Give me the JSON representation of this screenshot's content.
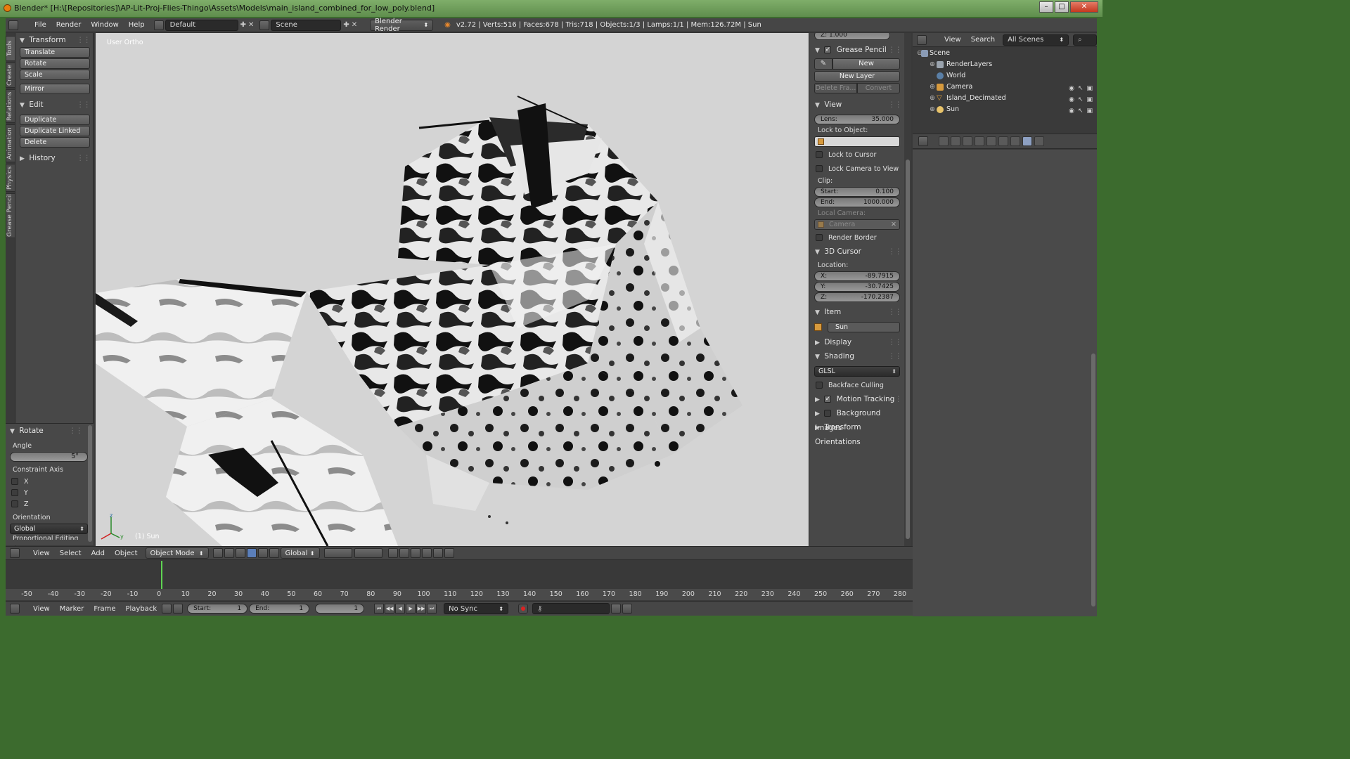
{
  "window": {
    "title": "Blender* [H:\\[Repositories]\\AP-Lit-Proj-Flies-Thingo\\Assets\\Models\\main_island_combined_for_low_poly.blend]",
    "controls": [
      "–",
      "□",
      "✕"
    ]
  },
  "topbar": {
    "menus": [
      "File",
      "Render",
      "Window",
      "Help"
    ],
    "layout": "Default",
    "scene": "Scene",
    "engine": "Blender Render",
    "stats": "v2.72 | Verts:516 | Faces:678 | Tris:718 | Objects:1/3 | Lamps:1/1 | Mem:126.72M | Sun"
  },
  "vertical_tabs": [
    "Tools",
    "Create",
    "Relations",
    "Animation",
    "Physics",
    "Grease Pencil"
  ],
  "toolshelf": {
    "transform": {
      "title": "Transform",
      "buttons": [
        "Translate",
        "Rotate",
        "Scale",
        "Mirror"
      ]
    },
    "edit": {
      "title": "Edit",
      "buttons": [
        "Duplicate",
        "Duplicate Linked",
        "Delete"
      ]
    },
    "history": {
      "title": "History"
    }
  },
  "operator": {
    "title": "Rotate",
    "angle_label": "Angle",
    "angle_value": "5°",
    "constraint_label": "Constraint Axis",
    "axes": [
      "X",
      "Y",
      "Z"
    ],
    "orientation_label": "Orientation",
    "orientation_value": "Global",
    "cutoff": "Proportional Editing"
  },
  "viewport": {
    "view_label": "User Ortho",
    "object_label": "(1) Sun",
    "axis_labels": [
      "z",
      "y"
    ]
  },
  "npanel": {
    "top_field": "Z:   1.000",
    "grease_pencil": {
      "title": "Grease Pencil",
      "new": "New",
      "new_layer": "New Layer",
      "delete_frame": "Delete Fra...",
      "convert": "Convert"
    },
    "view": {
      "title": "View",
      "lens_label": "Lens:",
      "lens_value": "35.000",
      "lock_object_label": "Lock to Object:",
      "lock_cursor": "Lock to Cursor",
      "lock_camera": "Lock Camera to View",
      "clip_label": "Clip:",
      "clip_start_label": "Start:",
      "clip_start_value": "0.100",
      "clip_end_label": "End:",
      "clip_end_value": "1000.000",
      "local_camera_label": "Local Camera:",
      "local_camera_value": "Camera",
      "render_border": "Render Border"
    },
    "cursor": {
      "title": "3D Cursor",
      "location_label": "Location:",
      "x_label": "X:",
      "x_value": "-89.7915",
      "y_label": "Y:",
      "y_value": "-30.7425",
      "z_label": "Z:",
      "z_value": "-170.2387"
    },
    "item": {
      "title": "Item",
      "name": "Sun"
    },
    "display": {
      "title": "Display"
    },
    "shading": {
      "title": "Shading",
      "mode": "GLSL",
      "backface": "Backface Culling"
    },
    "motion_tracking": {
      "title": "Motion Tracking"
    },
    "background_images": {
      "title": "Background Images"
    },
    "transform_orientations": {
      "title": "Transform Orientations"
    }
  },
  "outliner": {
    "menus": [
      "View",
      "Search"
    ],
    "filter": "All Scenes",
    "items": [
      "Scene",
      "RenderLayers",
      "World",
      "Camera",
      "Island_Decimated",
      "Sun"
    ]
  },
  "vp_header": {
    "menus": [
      "View",
      "Select",
      "Add",
      "Object"
    ],
    "mode": "Object Mode",
    "orientation": "Global"
  },
  "timeline": {
    "ticks": [
      "-50",
      "-40",
      "-30",
      "-20",
      "-10",
      "0",
      "10",
      "20",
      "30",
      "40",
      "50",
      "60",
      "70",
      "80",
      "90",
      "100",
      "110",
      "120",
      "130",
      "140",
      "150",
      "160",
      "170",
      "180",
      "190",
      "200",
      "210",
      "220",
      "230",
      "240",
      "250",
      "260",
      "270",
      "280"
    ],
    "current_frame": 1,
    "menus": [
      "View",
      "Marker",
      "Frame",
      "Playback"
    ],
    "start_label": "Start:",
    "start_value": "1",
    "end_label": "End:",
    "end_value": "1",
    "frame_value": "1",
    "sync": "No Sync"
  }
}
